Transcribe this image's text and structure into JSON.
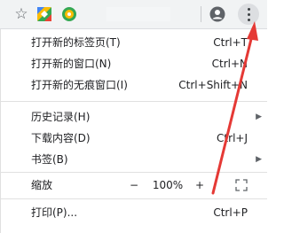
{
  "menu": {
    "new_tab": {
      "label": "打开新的标签页(T)",
      "shortcut": "Ctrl+T"
    },
    "new_window": {
      "label": "打开新的窗口(N)",
      "shortcut": "Ctrl+N"
    },
    "new_incognito": {
      "label": "打开新的无痕窗口(I)",
      "shortcut": "Ctrl+Shift+N"
    },
    "history": {
      "label": "历史记录(H)"
    },
    "downloads": {
      "label": "下载内容(D)",
      "shortcut": "Ctrl+J"
    },
    "bookmarks": {
      "label": "书签(B)"
    },
    "zoom": {
      "label": "缩放",
      "minus": "−",
      "value": "100%",
      "plus": "+"
    },
    "print": {
      "label": "打印(P)...",
      "shortcut": "Ctrl+P"
    }
  },
  "icons": {
    "star": "star-icon",
    "extension_1": "colorful-square-extension-icon",
    "extension_2": "green-yellow-circle-extension-icon",
    "avatar": "account-circle-icon",
    "menu": "vertical-dots-icon",
    "fullscreen": "fullscreen-icon"
  },
  "colors": {
    "toolbar_bg": "#f1f3f4",
    "annotation_arrow": "#e53935",
    "text": "#202124"
  }
}
